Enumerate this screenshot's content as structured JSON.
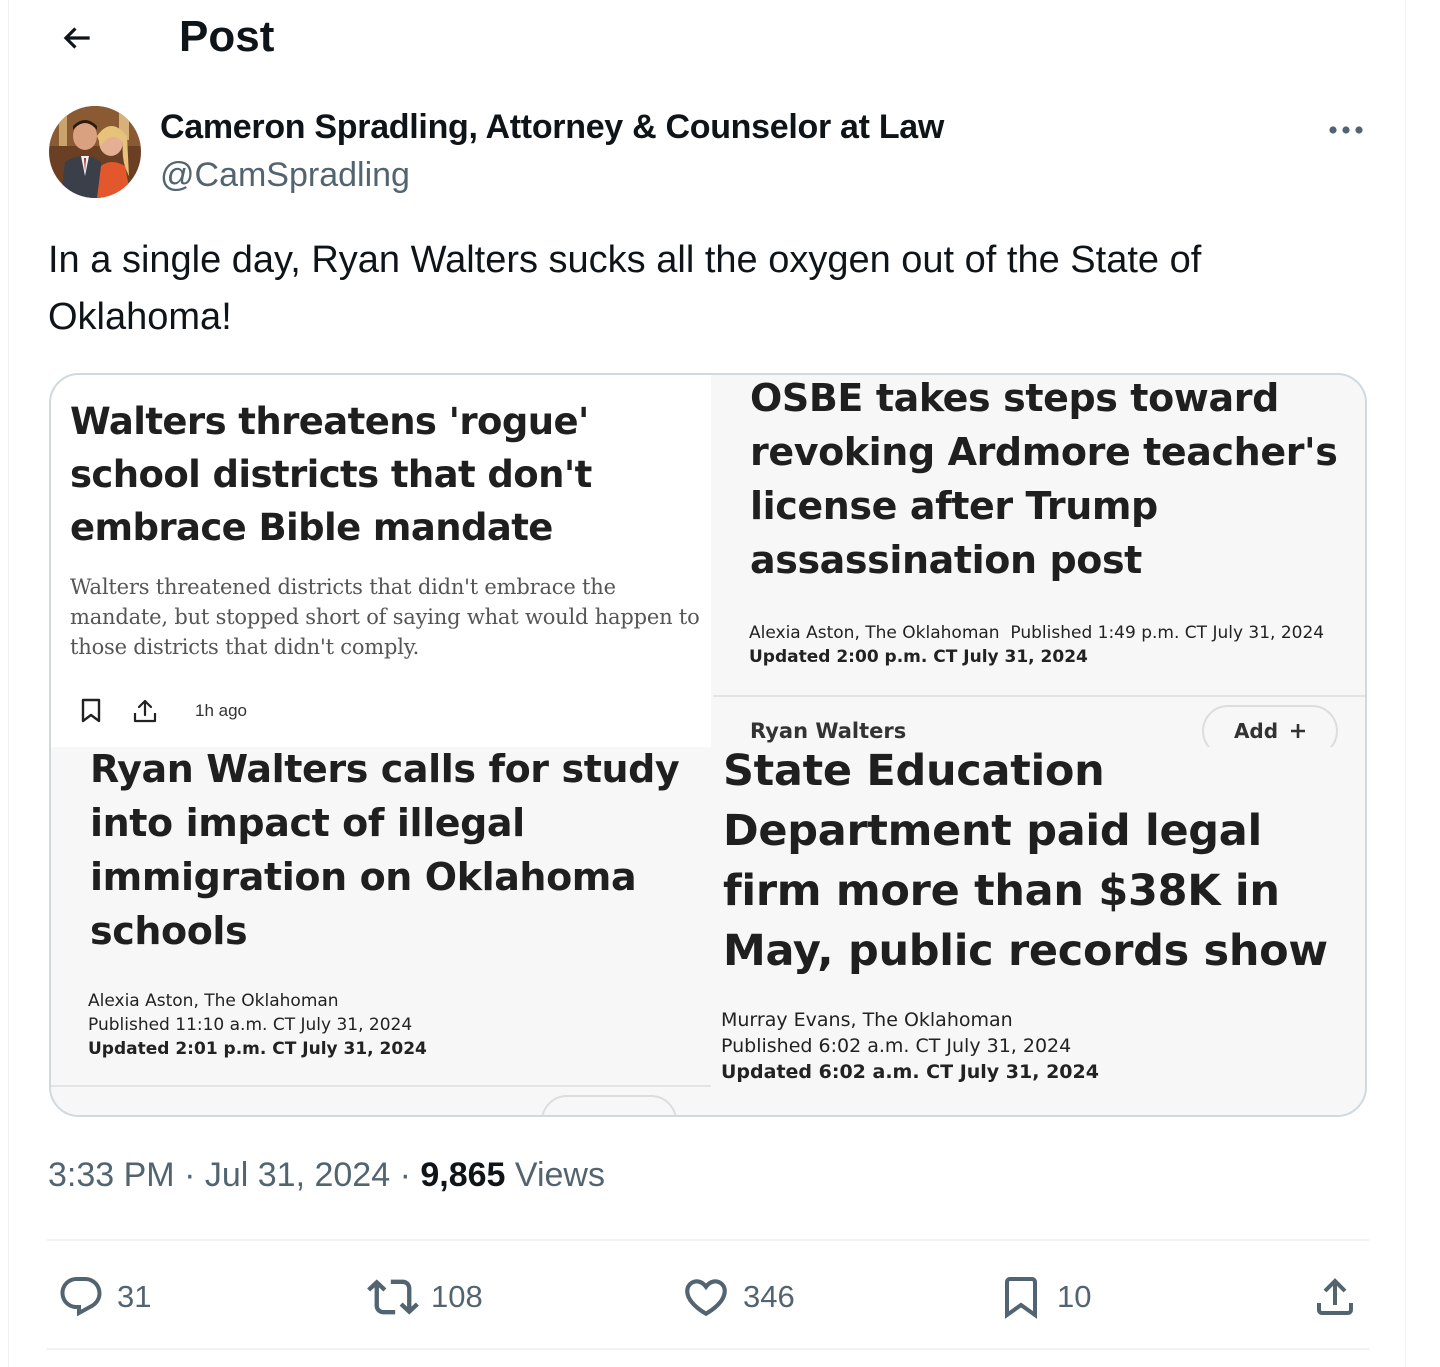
{
  "header": {
    "title": "Post",
    "back_icon": "arrow-left-icon"
  },
  "author": {
    "name": "Cameron Spradling, Attorney & Counselor at Law",
    "handle": "@CamSpradling",
    "more_icon": "more-horizontal-icon"
  },
  "post": {
    "text": "In a single day, Ryan Walters sucks all the oxygen out of the State of Oklahoma!"
  },
  "media": {
    "card1": {
      "headline": "Walters threatens 'rogue' school districts that don't embrace Bible mandate",
      "summary": "Walters threatened districts that didn't embrace the mandate, but stopped short of saying what would happen to those districts that didn't comply.",
      "time": "1h ago"
    },
    "card2": {
      "headline": "OSBE takes steps toward revoking Ardmore teacher's license after Trump assassination post",
      "byline": "Alexia Aston, The Oklahoman",
      "published": "Published 1:49 p.m. CT July 31, 2024",
      "updated": "Updated 2:00 p.m. CT July 31, 2024",
      "tag": "Ryan Walters",
      "add_label": "Add"
    },
    "card3": {
      "headline": "Ryan Walters calls for study into impact of illegal immigration on Oklahoma schools",
      "byline": "Alexia Aston, The Oklahoman",
      "published": "Published 11:10 a.m. CT July 31, 2024",
      "updated": "Updated 2:01 p.m. CT July 31, 2024"
    },
    "card4": {
      "headline": "State Education Department paid legal firm more than $38K in May, public records show",
      "byline": "Murray Evans, The Oklahoman",
      "published": "Published 6:02 a.m. CT July 31, 2024",
      "updated": "Updated 6:02 a.m. CT July 31, 2024"
    }
  },
  "meta": {
    "time": "3:33 PM",
    "separator": "·",
    "date": "Jul 31, 2024",
    "views_count": "9,865",
    "views_label": "Views"
  },
  "actions": {
    "replies": "31",
    "reposts": "108",
    "likes": "346",
    "bookmarks": "10"
  },
  "colors": {
    "text": "#0f1419",
    "muted": "#536471",
    "border": "#cfd9de"
  }
}
